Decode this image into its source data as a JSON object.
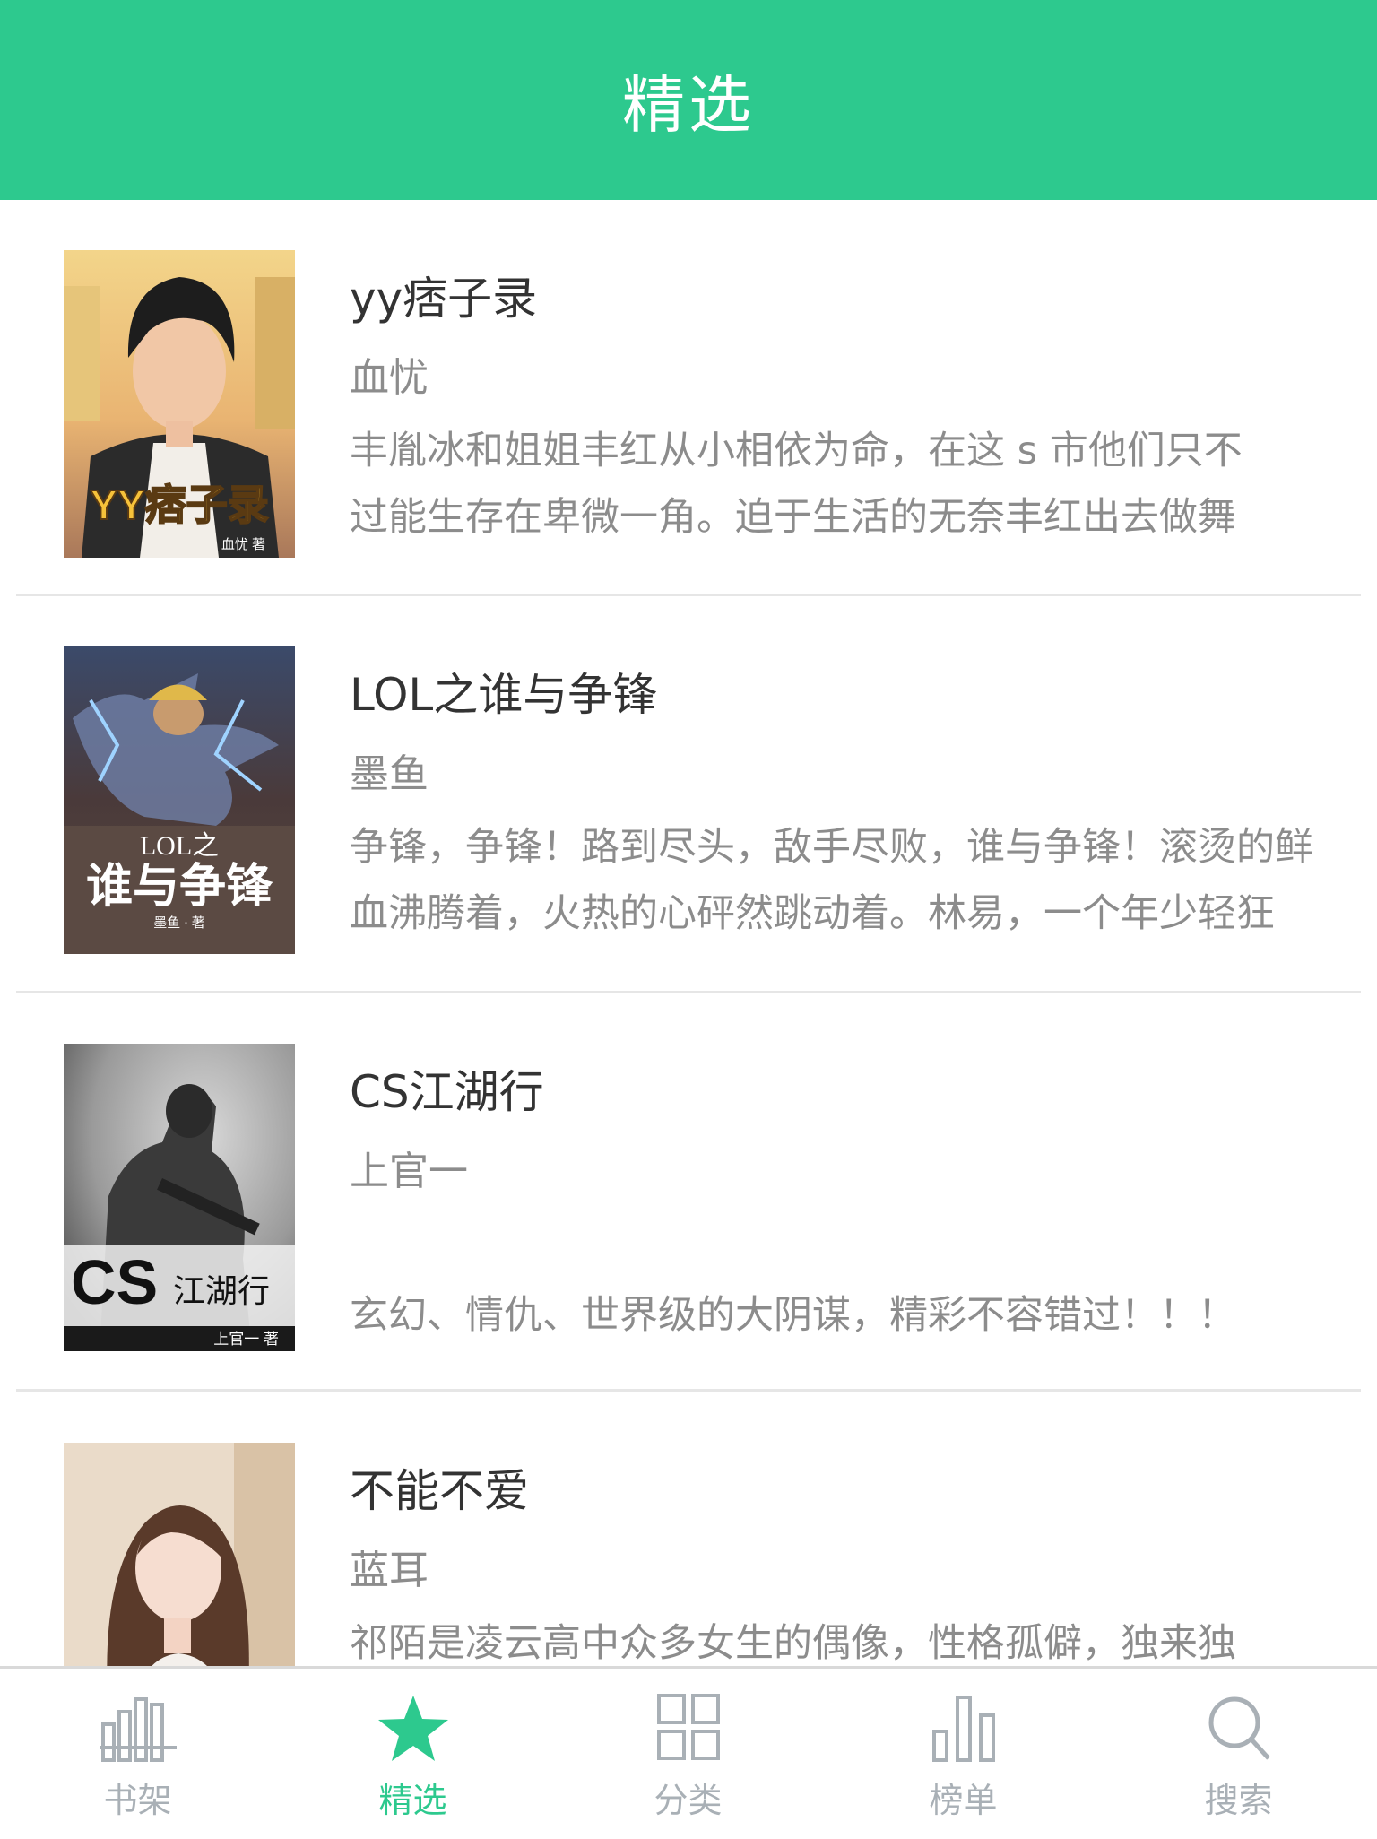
{
  "header": {
    "title": "精选"
  },
  "books": [
    {
      "title": "yy痞子录",
      "author": "血忧",
      "desc_lines": [
        "丰胤冰和姐姐丰红从小相依为命，在这 s 市他们只不",
        "过能生存在卑微一角。迫于生活的无奈丰红出去做舞"
      ],
      "cover_title": "YY痞子录",
      "cover_author": "血忧 著"
    },
    {
      "title": "LOL之谁与争锋",
      "author": "墨鱼",
      "desc_lines": [
        "争锋，争锋！路到尽头，敌手尽败，谁与争锋！滚烫的鲜",
        "血沸腾着，火热的心砰然跳动着。林易，一个年少轻狂"
      ],
      "cover_title_small": "LOL之",
      "cover_title": "谁与争锋",
      "cover_author": "墨鱼 · 著"
    },
    {
      "title": "CS江湖行",
      "author": "上官一",
      "desc_lines": [
        "玄幻、情仇、世界级的大阴谋，精彩不容错过！！！"
      ],
      "cover_title_big": "CS",
      "cover_title": "江湖行",
      "cover_author": "上官一 著"
    },
    {
      "title": "不能不爱",
      "author": "蓝耳",
      "desc_lines": [
        "祁陌是凌云高中众多女生的偶像，性格孤僻，独来独"
      ]
    }
  ],
  "tabbar": {
    "tabs": [
      {
        "label": "书架",
        "icon": "bookshelf-icon",
        "active": false
      },
      {
        "label": "精选",
        "icon": "star-icon",
        "active": true
      },
      {
        "label": "分类",
        "icon": "grid-icon",
        "active": false
      },
      {
        "label": "榜单",
        "icon": "bar-chart-icon",
        "active": false
      },
      {
        "label": "搜索",
        "icon": "search-icon",
        "active": false
      }
    ]
  },
  "colors": {
    "accent": "#2dc98e",
    "inactive": "#a9b0b6",
    "text": "#333333",
    "muted": "#8c8c8c"
  }
}
